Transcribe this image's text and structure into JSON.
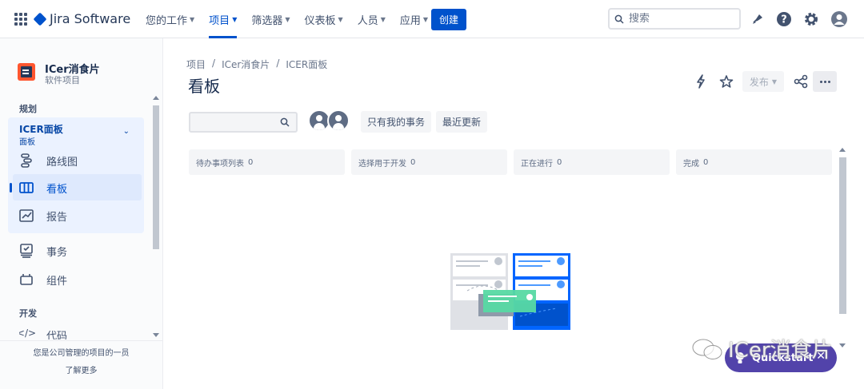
{
  "topnav": {
    "logo_text": "Jira Software",
    "items": [
      {
        "label": "您的工作"
      },
      {
        "label": "项目"
      },
      {
        "label": "筛选器"
      },
      {
        "label": "仪表板"
      },
      {
        "label": "人员"
      },
      {
        "label": "应用"
      }
    ],
    "create_label": "创建",
    "search_placeholder": "搜索"
  },
  "sidebar": {
    "project_name": "ICer消食片",
    "project_type": "软件项目",
    "section_plan": "规划",
    "board_selector": {
      "name": "ICER面板",
      "sub": "面板"
    },
    "items_plan": [
      {
        "label": "路线图"
      },
      {
        "label": "看板"
      },
      {
        "label": "报告"
      }
    ],
    "items_other": [
      {
        "label": "事务"
      },
      {
        "label": "组件"
      }
    ],
    "section_dev": "开发",
    "item_code": "代码",
    "footer_text": "您是公司管理的项目的一员",
    "footer_link": "了解更多"
  },
  "main": {
    "breadcrumb": [
      "项目",
      "ICer消食片",
      "ICER面板"
    ],
    "title": "看板",
    "release_label": "发布",
    "filters": {
      "only_my": "只有我的事务",
      "recent": "最近更新"
    },
    "columns": [
      {
        "name": "待办事项列表",
        "count": "0"
      },
      {
        "name": "选择用于开发",
        "count": "0"
      },
      {
        "name": "正在进行",
        "count": "0"
      },
      {
        "name": "完成",
        "count": "0"
      }
    ]
  },
  "quickstart_label": "Quickstart",
  "watermark_text": "ICer消食片",
  "colors": {
    "brand": "#0052cc",
    "quickstart": "#5243aa",
    "active_bg": "#dee9fd"
  }
}
